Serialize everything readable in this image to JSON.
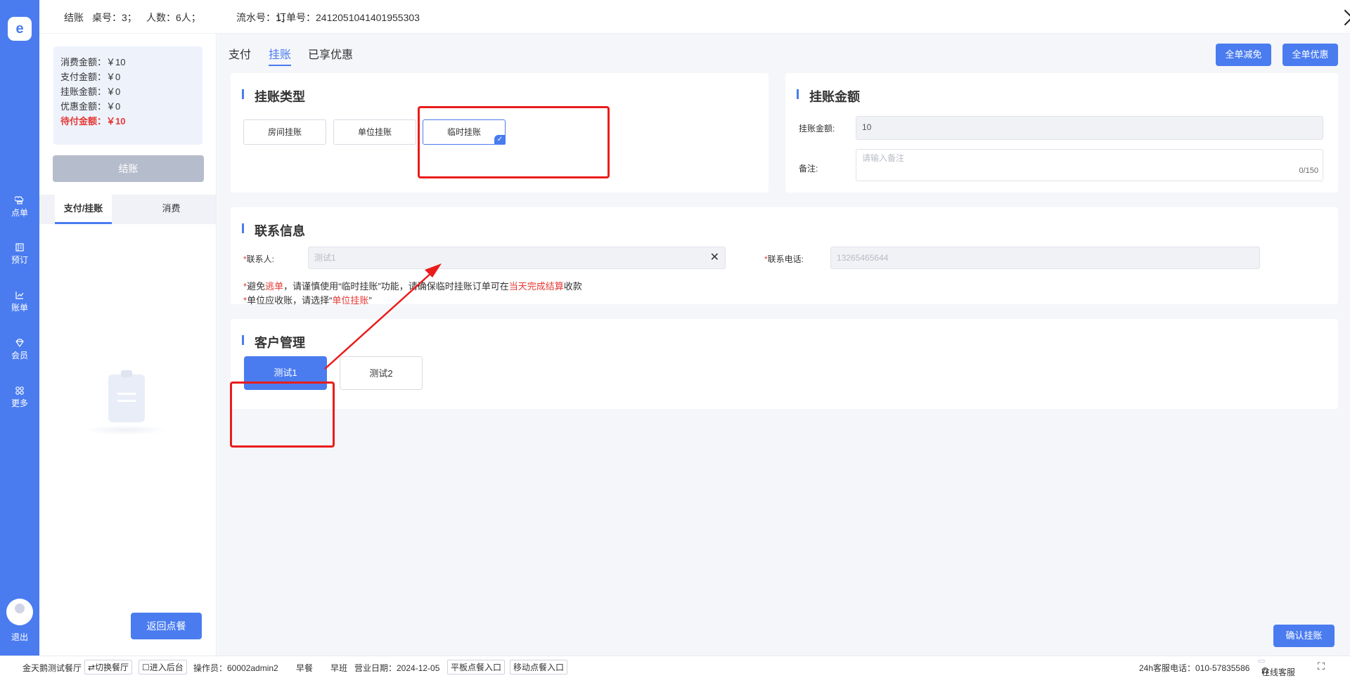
{
  "sidebar": {
    "logo": "e",
    "items": [
      {
        "label": "点单",
        "icon": "chef-hat-icon"
      },
      {
        "label": "预订",
        "icon": "book-icon"
      },
      {
        "label": "账单",
        "icon": "chart-icon"
      },
      {
        "label": "会员",
        "icon": "diamond-icon"
      },
      {
        "label": "更多",
        "icon": "grid-icon"
      }
    ],
    "exit": "退出"
  },
  "header": {
    "title": "结账",
    "table": "桌号：3；",
    "people": "人数：6人；",
    "serial": "流水号：1；",
    "order": "订单号：2412051041401955303"
  },
  "summary": {
    "consume": "消费金额：￥10",
    "paid": "支付金额：￥0",
    "credit": "挂账金额：￥0",
    "discount": "优惠金额：￥0",
    "due": "待付金额：￥10"
  },
  "checkout_label": "结账",
  "left_tabs": [
    "支付/挂账",
    "消费"
  ],
  "back_label": "返回点餐",
  "main_tabs": [
    "支付",
    "挂账",
    "已享优惠"
  ],
  "top_buttons": [
    "全单减免",
    "全单优惠"
  ],
  "credit_type": {
    "title": "挂账类型",
    "options": [
      "房间挂账",
      "单位挂账",
      "临时挂账"
    ],
    "selected": "临时挂账"
  },
  "credit_amount": {
    "title": "挂账金额",
    "amount_label": "挂账金额:",
    "amount_value": "10",
    "remark_label": "备注:",
    "remark_placeholder": "请输入备注",
    "remark_counter": "0/150"
  },
  "contact": {
    "title": "联系信息",
    "star": "*",
    "name_label": "联系人:",
    "name_value": "测试1",
    "phone_label": "联系电话:",
    "phone_value": "13265465644",
    "note1_a": "避免",
    "note1_b": "逃单",
    "note1_c": "，请谨慎使用“临时挂账”功能，请确保临时挂账订单可在",
    "note1_d": "当天完成结算",
    "note1_e": "收款",
    "note2_a": "单位应收账，请选择“",
    "note2_b": "单位挂账",
    "note2_c": "”"
  },
  "customers": {
    "title": "客户管理",
    "items": [
      "测试1",
      "测试2"
    ],
    "selected": "测试1"
  },
  "confirm_label": "确认挂账",
  "footer": {
    "store": "金天鹅测试餐厅",
    "switch": "⇄切换餐厅",
    "backend": "☐进入后台",
    "operator": "操作员：60002admin2",
    "meal": "早餐",
    "shift": "早班",
    "bizdate": "营业日期：2024-12-05",
    "tablet": "平板点餐入口",
    "mobile": "移动点餐入口",
    "service": "24h客服电话：010-57835586",
    "online": "在线客服"
  },
  "colors": {
    "accent": "#4a7cf0",
    "annotation": "#ea1c1c",
    "warn": "#e53935"
  }
}
